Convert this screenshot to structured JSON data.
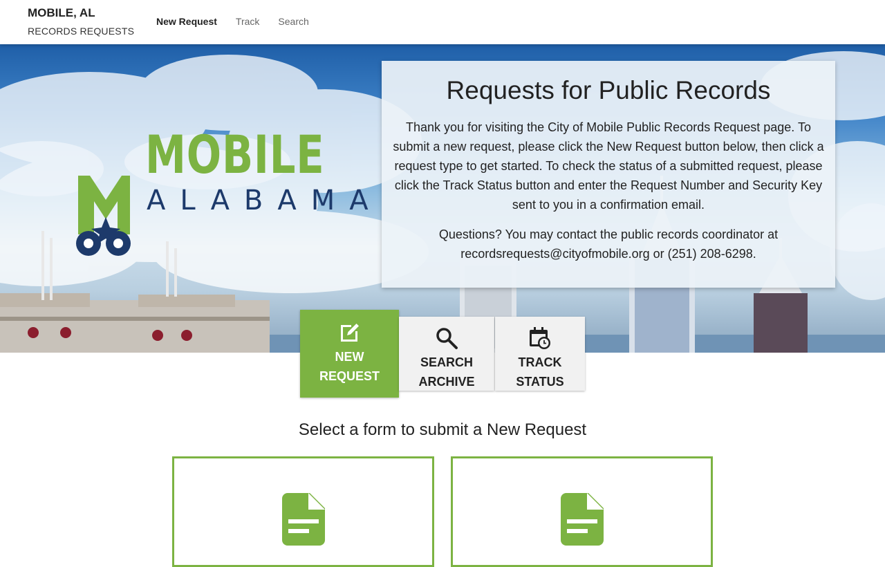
{
  "header": {
    "city": "MOBILE, AL",
    "subtitle": "RECORDS REQUESTS",
    "nav": [
      "New Request",
      "Track",
      "Search"
    ]
  },
  "hero": {
    "logo_big": "MOBILE",
    "logo_small": "ALABAMA"
  },
  "info": {
    "title": "Requests for Public Records",
    "body": "Thank you for visiting the City of Mobile Public Records Request page. To submit a new request, please click the New Request button below, then click a request type to get started. To check the status of a submitted request, please click the Track Status button and enter the Request Number and Security Key sent to you in a confirmation email.",
    "questions": "Questions? You may contact the public records coordinator at recordsrequests@cityofmobile.org or (251) 208-6298."
  },
  "actions": [
    {
      "line1": "NEW",
      "line2": "REQUEST",
      "icon": "edit-icon"
    },
    {
      "line1": "SEARCH",
      "line2": "ARCHIVE",
      "icon": "search-icon"
    },
    {
      "line1": "TRACK",
      "line2": "STATUS",
      "icon": "calendar-clock-icon"
    }
  ],
  "section_title": "Select a form to submit a New Request",
  "forms": [
    {
      "icon": "document-icon"
    },
    {
      "icon": "document-icon"
    }
  ],
  "colors": {
    "accent": "#7cb342",
    "logo_blue": "#1d3a6b",
    "button_bg": "#f1f1f1"
  }
}
